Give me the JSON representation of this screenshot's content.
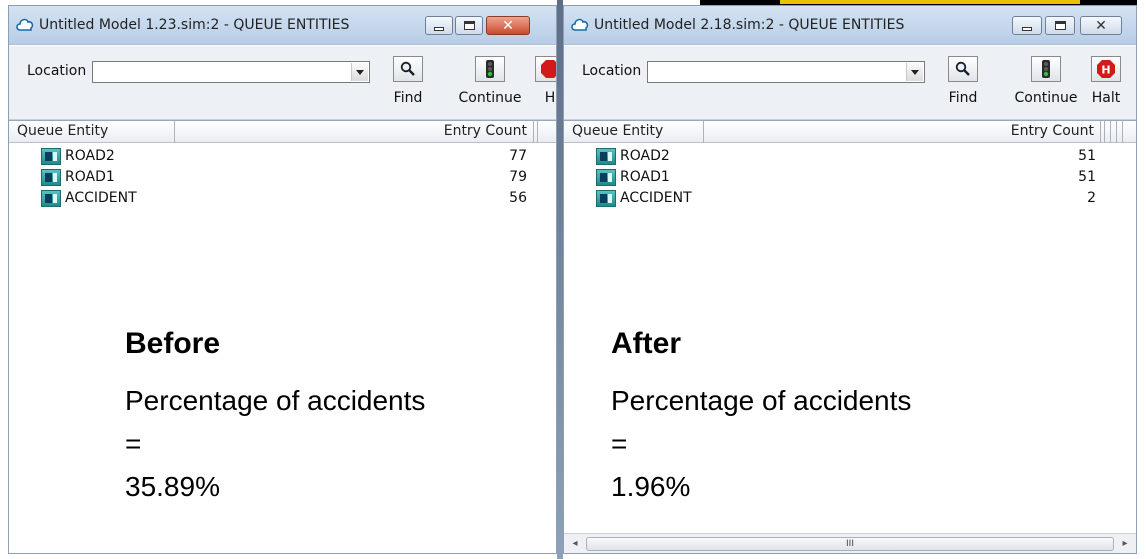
{
  "windows": [
    {
      "title": "Untitled Model 1.23.sim:2  -  QUEUE ENTITIES",
      "location_label": "Location",
      "location_value": "",
      "toolbar": [
        {
          "label": "Find",
          "icon": "magnifier-icon"
        },
        {
          "label": "Continue",
          "icon": "traffic-light-icon"
        },
        {
          "label": "H",
          "icon": "halt-icon"
        }
      ],
      "columns": {
        "entity": "Queue Entity",
        "count": "Entry Count"
      },
      "rows": [
        {
          "name": "ROAD2",
          "count": "77"
        },
        {
          "name": "ROAD1",
          "count": "79"
        },
        {
          "name": "ACCIDENT",
          "count": "56"
        }
      ],
      "caption": {
        "title": "Before",
        "line1": "Percentage of accidents",
        "line2": "=",
        "line3": "35.89%"
      }
    },
    {
      "title": "Untitled Model 2.18.sim:2  -  QUEUE ENTITIES",
      "location_label": "Location",
      "location_value": "",
      "toolbar": [
        {
          "label": "Find",
          "icon": "magnifier-icon"
        },
        {
          "label": "Continue",
          "icon": "traffic-light-icon"
        },
        {
          "label": "Halt",
          "icon": "halt-icon"
        }
      ],
      "columns": {
        "entity": "Queue Entity",
        "count": "Entry Count"
      },
      "rows": [
        {
          "name": "ROAD2",
          "count": "51"
        },
        {
          "name": "ROAD1",
          "count": "51"
        },
        {
          "name": "ACCIDENT",
          "count": "2"
        }
      ],
      "caption": {
        "title": "After",
        "line1": "Percentage of accidents",
        "line2": "=",
        "line3": "1.96%"
      },
      "scrollbar": {
        "grip": "III"
      }
    }
  ],
  "colors": {
    "titlebar": "#c6d8ee",
    "queue_icon": "#1b8c8c",
    "halt_red": "#d31a1a",
    "light_green": "#2fbf3a"
  }
}
